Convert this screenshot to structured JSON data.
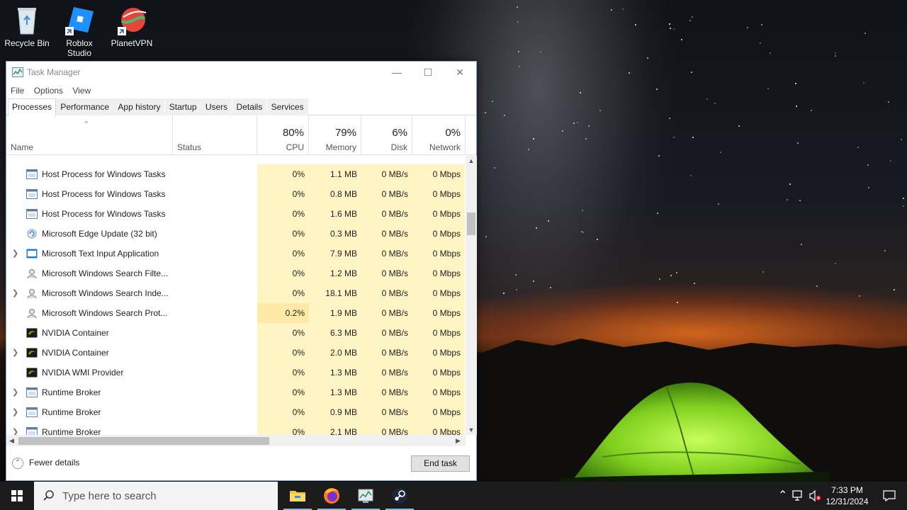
{
  "desktop": {
    "icons": [
      {
        "label": "Recycle Bin",
        "icon": "recycle-bin-icon"
      },
      {
        "label": "Roblox Studio",
        "icon": "roblox-studio-icon"
      },
      {
        "label": "PlanetVPN",
        "icon": "planetvpn-icon"
      }
    ]
  },
  "task_manager": {
    "title": "Task Manager",
    "menu": [
      "File",
      "Options",
      "View"
    ],
    "tabs": [
      "Processes",
      "Performance",
      "App history",
      "Startup",
      "Users",
      "Details",
      "Services"
    ],
    "active_tab": "Processes",
    "columns": {
      "name": "Name",
      "status": "Status",
      "cpu": {
        "pct": "80%",
        "label": "CPU"
      },
      "memory": {
        "pct": "79%",
        "label": "Memory"
      },
      "disk": {
        "pct": "6%",
        "label": "Disk"
      },
      "network": {
        "pct": "0%",
        "label": "Network"
      }
    },
    "processes": [
      {
        "name": "Host Process for Windows Tasks",
        "expandable": false,
        "icon": "window-process-icon",
        "cpu": "0%",
        "memory": "1.1 MB",
        "disk": "0 MB/s",
        "network": "0 Mbps"
      },
      {
        "name": "Host Process for Windows Tasks",
        "expandable": false,
        "icon": "window-process-icon",
        "cpu": "0%",
        "memory": "0.8 MB",
        "disk": "0 MB/s",
        "network": "0 Mbps"
      },
      {
        "name": "Host Process for Windows Tasks",
        "expandable": false,
        "icon": "window-process-icon",
        "cpu": "0%",
        "memory": "1.6 MB",
        "disk": "0 MB/s",
        "network": "0 Mbps"
      },
      {
        "name": "Microsoft Edge Update (32 bit)",
        "expandable": false,
        "icon": "edge-update-icon",
        "cpu": "0%",
        "memory": "0.3 MB",
        "disk": "0 MB/s",
        "network": "0 Mbps"
      },
      {
        "name": "Microsoft Text Input Application",
        "expandable": true,
        "icon": "text-input-icon",
        "cpu": "0%",
        "memory": "7.9 MB",
        "disk": "0 MB/s",
        "network": "0 Mbps"
      },
      {
        "name": "Microsoft Windows Search Filte...",
        "expandable": false,
        "icon": "search-user-icon",
        "cpu": "0%",
        "memory": "1.2 MB",
        "disk": "0 MB/s",
        "network": "0 Mbps"
      },
      {
        "name": "Microsoft Windows Search Inde...",
        "expandable": true,
        "icon": "search-user-icon",
        "cpu": "0%",
        "memory": "18.1 MB",
        "disk": "0 MB/s",
        "network": "0 Mbps"
      },
      {
        "name": "Microsoft Windows Search Prot...",
        "expandable": false,
        "icon": "search-user-icon",
        "cpu": "0.2%",
        "memory": "1.9 MB",
        "disk": "0 MB/s",
        "network": "0 Mbps"
      },
      {
        "name": "NVIDIA Container",
        "expandable": false,
        "icon": "nvidia-icon",
        "cpu": "0%",
        "memory": "6.3 MB",
        "disk": "0 MB/s",
        "network": "0 Mbps"
      },
      {
        "name": "NVIDIA Container",
        "expandable": true,
        "icon": "nvidia-icon",
        "cpu": "0%",
        "memory": "2.0 MB",
        "disk": "0 MB/s",
        "network": "0 Mbps"
      },
      {
        "name": "NVIDIA WMI Provider",
        "expandable": false,
        "icon": "nvidia-icon",
        "cpu": "0%",
        "memory": "1.3 MB",
        "disk": "0 MB/s",
        "network": "0 Mbps"
      },
      {
        "name": "Runtime Broker",
        "expandable": true,
        "icon": "window-process-icon",
        "cpu": "0%",
        "memory": "1.3 MB",
        "disk": "0 MB/s",
        "network": "0 Mbps"
      },
      {
        "name": "Runtime Broker",
        "expandable": true,
        "icon": "window-process-icon",
        "cpu": "0%",
        "memory": "0.9 MB",
        "disk": "0 MB/s",
        "network": "0 Mbps"
      },
      {
        "name": "Runtime Broker",
        "expandable": true,
        "icon": "window-process-icon",
        "cpu": "0%",
        "memory": "2.1 MB",
        "disk": "0 MB/s",
        "network": "0 Mbps"
      }
    ],
    "footer": {
      "fewer_details": "Fewer details",
      "end_task": "End task"
    }
  },
  "taskbar": {
    "search_placeholder": "Type here to search",
    "pinned": [
      "file-explorer-icon",
      "firefox-icon",
      "task-manager-icon",
      "steam-icon"
    ],
    "clock": {
      "time": "7:33 PM",
      "date": "12/31/2024"
    }
  },
  "colors": {
    "heat_light": "#fff4c4",
    "heat_medium": "#ffe9a6",
    "taskbar": "#1b1b1b",
    "accent": "#76b9ed"
  }
}
